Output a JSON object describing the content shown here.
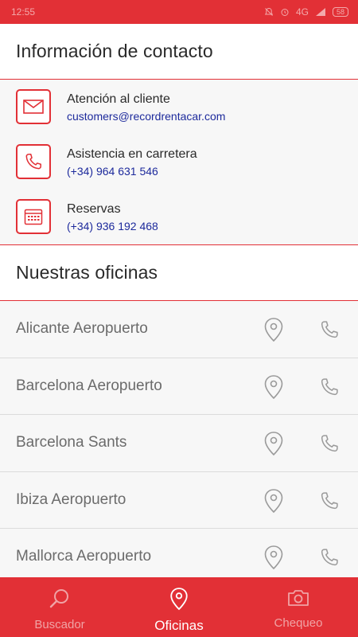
{
  "status_bar": {
    "time": "12:55",
    "network": "4G",
    "battery": "58"
  },
  "contact_section": {
    "title": "Información de contacto",
    "items": [
      {
        "icon": "mail-icon",
        "title": "Atención al cliente",
        "value": "customers@recordrentacar.com"
      },
      {
        "icon": "phone-icon",
        "title": "Asistencia en carretera",
        "value": "(+34) 964 631 546"
      },
      {
        "icon": "calendar-icon",
        "title": "Reservas",
        "value": "(+34) 936 192 468"
      }
    ]
  },
  "offices_section": {
    "title": "Nuestras oficinas",
    "offices": [
      {
        "name": "Alicante Aeropuerto"
      },
      {
        "name": "Barcelona Aeropuerto"
      },
      {
        "name": "Barcelona Sants"
      },
      {
        "name": "Ibiza Aeropuerto"
      },
      {
        "name": "Mallorca Aeropuerto"
      }
    ]
  },
  "bottom_nav": {
    "items": [
      {
        "label": "Buscador",
        "icon": "search-icon",
        "active": false
      },
      {
        "label": "Oficinas",
        "icon": "location-pin-icon",
        "active": true
      },
      {
        "label": "Chequeo",
        "icon": "camera-icon",
        "active": false
      }
    ]
  },
  "colors": {
    "brand_red": "#e23036",
    "link_blue": "#1d2a9c",
    "text_dark": "#2a2a2a",
    "text_gray": "#6b6b6b"
  }
}
